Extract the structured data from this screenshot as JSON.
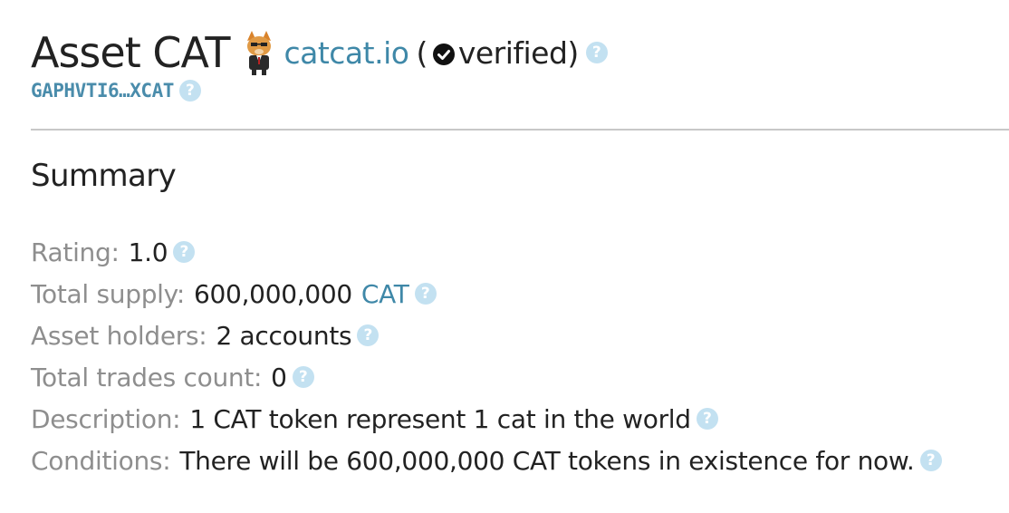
{
  "asset": {
    "title": "Asset CAT",
    "domain": "catcat.io",
    "paren_open": "(",
    "verified_label": "verified)",
    "address": "GAPHVTI6…XCAT"
  },
  "summary": {
    "heading": "Summary",
    "rating_label": "Rating:",
    "rating_value": "1.0",
    "supply_label": "Total supply:",
    "supply_value": "600,000,000",
    "supply_code": "CAT",
    "holders_label": "Asset holders:",
    "holders_value": "2 accounts",
    "trades_label": "Total trades count:",
    "trades_value": "0",
    "description_label": "Description:",
    "description_value": "1 CAT token represent 1 cat in the world",
    "conditions_label": "Conditions:",
    "conditions_value": "There will be 600,000,000 CAT tokens in existence for now."
  },
  "help_glyph": "?",
  "colors": {
    "link": "#3f88a8",
    "label_gray": "#8e8e8e",
    "help_icon_bg": "#c3e1f1",
    "divider": "#c8c8c8"
  },
  "icons": {
    "logo": "cat-logo-icon",
    "verified": "verified-check-icon",
    "help": "help-icon"
  }
}
